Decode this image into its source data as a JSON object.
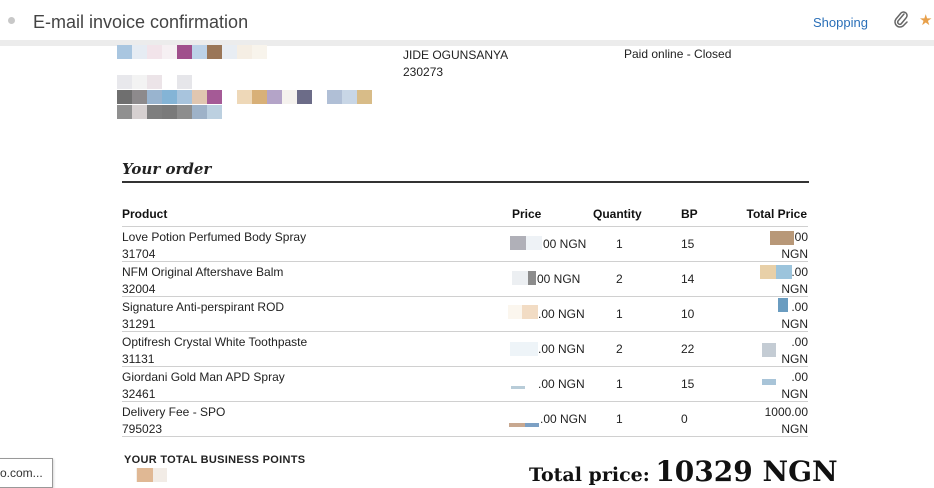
{
  "header": {
    "subject": "E-mail invoice confirmation",
    "label": "Shopping"
  },
  "customer": {
    "name": "JIDE OGUNSANYA",
    "id": "230273",
    "status": "Paid online - Closed"
  },
  "order": {
    "section_title": "Your order",
    "columns": [
      "Product",
      "Price",
      "Quantity",
      "BP",
      "Total Price"
    ],
    "rows": [
      {
        "product": "Love Potion Perfumed Body Spray",
        "code": "31704",
        "price_suffix": "00 NGN",
        "qty": "1",
        "bp": "15",
        "total_suffix": "00",
        "total_unit": "NGN"
      },
      {
        "product": "NFM Original Aftershave Balm",
        "code": "32004",
        "price_suffix": "00 NGN",
        "qty": "2",
        "bp": "14",
        "total_suffix": ".00",
        "total_unit": "NGN"
      },
      {
        "product": "Signature Anti-perspirant ROD",
        "code": "31291",
        "price_suffix": ".00 NGN",
        "qty": "1",
        "bp": "10",
        "total_suffix": ".00",
        "total_unit": "NGN"
      },
      {
        "product": "Optifresh Crystal White Toothpaste",
        "code": "31131",
        "price_suffix": ".00 NGN",
        "qty": "2",
        "bp": "22",
        "total_suffix": ".00",
        "total_unit": "NGN"
      },
      {
        "product": "Giordani Gold Man APD Spray",
        "code": "32461",
        "price_suffix": ".00 NGN",
        "qty": "1",
        "bp": "15",
        "total_suffix": ".00",
        "total_unit": "NGN"
      },
      {
        "product": "Delivery Fee - SPO",
        "code": "795023",
        "price_suffix": ".00 NGN",
        "qty": "1",
        "bp": "0",
        "total_suffix": "1000.00",
        "total_unit": "NGN"
      }
    ]
  },
  "footer": {
    "business_points_label": "YOUR TOTAL BUSINESS POINTS",
    "total_label": "Total price:",
    "total_value": "10329 NGN"
  },
  "tooltip": {
    "text": "o.com..."
  },
  "colors": {
    "accent_link": "#2a6fb8",
    "star": "#e8a04a"
  }
}
